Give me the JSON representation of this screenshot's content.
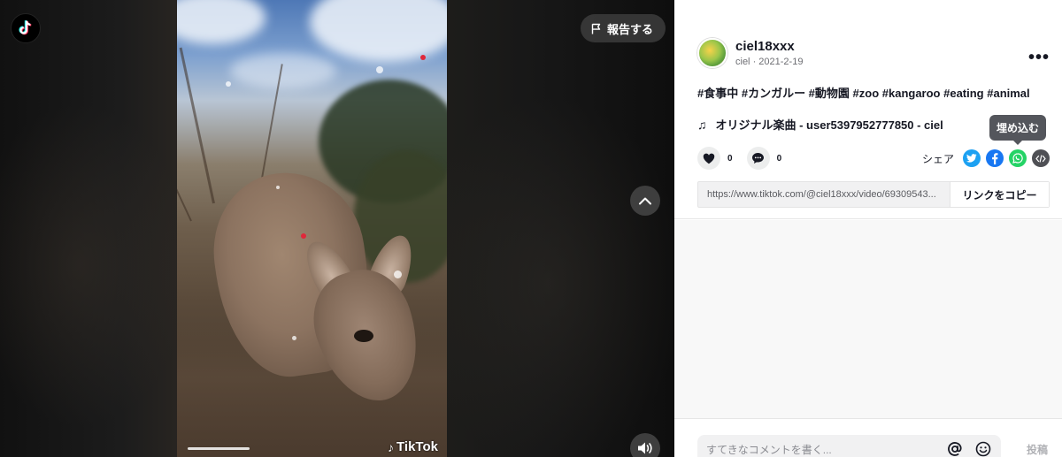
{
  "report_label": "報告する",
  "watermark": "TikTok",
  "author": {
    "username": "ciel18xxx",
    "nickname": "ciel",
    "separator": " · ",
    "date": "2021-2-19"
  },
  "more_label": "•••",
  "caption": "#食事中 #カンガルー #動物園 #zoo #kangaroo #eating #animal",
  "music": {
    "note_icon": "♫",
    "text": "オリジナル楽曲 - user5397952777850 - ciel"
  },
  "tooltip": "埋め込む",
  "stats": {
    "likes": "0",
    "comments": "0"
  },
  "share_label": "シェア",
  "link": {
    "url": "https://www.tiktok.com/@ciel18xxx/video/69309543...",
    "copy_label": "リンクをコピー"
  },
  "comment_box": {
    "placeholder": "すてきなコメントを書く...",
    "post_label": "投稿"
  },
  "icons": {
    "logo": "tiktok-logo-icon",
    "flag": "flag-icon",
    "up": "chevron-up-icon",
    "sound": "speaker-icon",
    "heart": "heart-icon",
    "comment": "comment-icon",
    "twitter": "twitter-icon",
    "facebook": "facebook-icon",
    "whatsapp": "whatsapp-icon",
    "embed": "embed-code-icon",
    "mention": "at-icon",
    "emoji": "emoji-icon"
  },
  "colors": {
    "twitter": "#1da1f2",
    "facebook": "#1877f2",
    "whatsapp": "#25d366",
    "embed": "#4f5055"
  }
}
